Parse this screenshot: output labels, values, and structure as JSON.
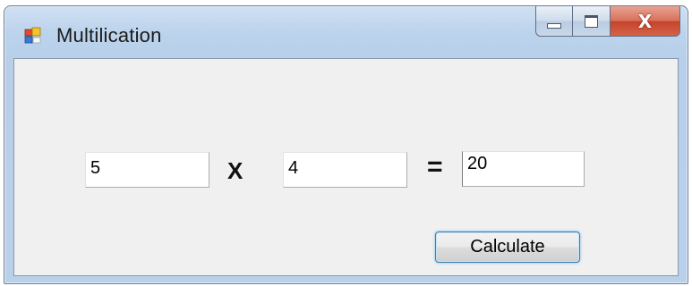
{
  "window": {
    "title": "Multilication",
    "controls": {
      "minimize_icon": "minimize-icon",
      "maximize_icon": "maximize-icon",
      "close_glyph": "X"
    }
  },
  "form": {
    "operand1_value": "5",
    "operator_label": "X",
    "operand2_value": "4",
    "equals_label": "=",
    "result_value": "20",
    "calculate_button_label": "Calculate"
  },
  "colors": {
    "title_bar": "#bcd3ec",
    "client_background": "#f0f0f0",
    "close_button": "#c4442a",
    "button_border": "#3c7fb1"
  }
}
